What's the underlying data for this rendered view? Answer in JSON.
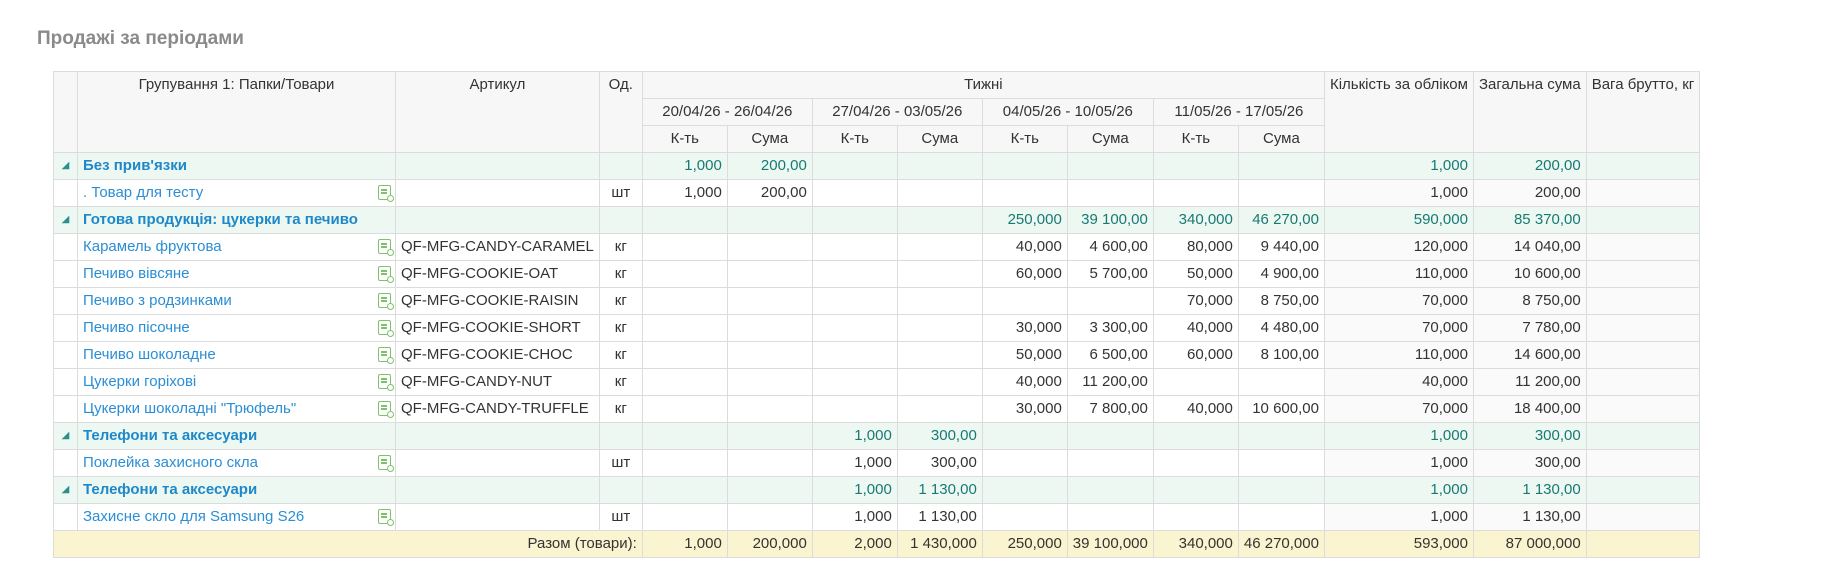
{
  "title": "Продажі за періодами",
  "header": {
    "grouping": "Групування 1: Папки/Товари",
    "article": "Артикул",
    "unit": "Од.",
    "weeks": "Тижні",
    "periods": [
      "20/04/26 - 26/04/26",
      "27/04/26 - 03/05/26",
      "04/05/26 - 10/05/26",
      "11/05/26 - 17/05/26"
    ],
    "qty": "К-ть",
    "sum": "Сума",
    "qty_total": "Кількість за обліком",
    "sum_total": "Загальна сума",
    "weight": "Вага брутто, кг"
  },
  "rows": [
    {
      "type": "group",
      "name": "Без прив'язки",
      "article": "",
      "unit": "",
      "cells": [
        "1,000",
        "200,00",
        "",
        "",
        "",
        "",
        "",
        ""
      ],
      "qty_total": "1,000",
      "sum_total": "200,00",
      "weight": ""
    },
    {
      "type": "item",
      "name": ". Товар для тесту",
      "article": "",
      "unit": "шт",
      "cells": [
        "1,000",
        "200,00",
        "",
        "",
        "",
        "",
        "",
        ""
      ],
      "qty_total": "1,000",
      "sum_total": "200,00",
      "weight": ""
    },
    {
      "type": "group",
      "name": "Готова продукція: цукерки та печиво",
      "article": "",
      "unit": "",
      "cells": [
        "",
        "",
        "",
        "",
        "250,000",
        "39 100,00",
        "340,000",
        "46 270,00"
      ],
      "qty_total": "590,000",
      "sum_total": "85 370,00",
      "weight": ""
    },
    {
      "type": "item",
      "name": "Карамель фруктова",
      "article": "QF-MFG-CANDY-CARAMEL",
      "unit": "кг",
      "cells": [
        "",
        "",
        "",
        "",
        "40,000",
        "4 600,00",
        "80,000",
        "9 440,00"
      ],
      "qty_total": "120,000",
      "sum_total": "14 040,00",
      "weight": ""
    },
    {
      "type": "item",
      "name": "Печиво вівсяне",
      "article": "QF-MFG-COOKIE-OAT",
      "unit": "кг",
      "cells": [
        "",
        "",
        "",
        "",
        "60,000",
        "5 700,00",
        "50,000",
        "4 900,00"
      ],
      "qty_total": "110,000",
      "sum_total": "10 600,00",
      "weight": ""
    },
    {
      "type": "item",
      "name": "Печиво з родзинками",
      "article": "QF-MFG-COOKIE-RAISIN",
      "unit": "кг",
      "cells": [
        "",
        "",
        "",
        "",
        "",
        "",
        "70,000",
        "8 750,00"
      ],
      "qty_total": "70,000",
      "sum_total": "8 750,00",
      "weight": ""
    },
    {
      "type": "item",
      "name": "Печиво пісочне",
      "article": "QF-MFG-COOKIE-SHORT",
      "unit": "кг",
      "cells": [
        "",
        "",
        "",
        "",
        "30,000",
        "3 300,00",
        "40,000",
        "4 480,00"
      ],
      "qty_total": "70,000",
      "sum_total": "7 780,00",
      "weight": ""
    },
    {
      "type": "item",
      "name": "Печиво шоколадне",
      "article": "QF-MFG-COOKIE-CHOC",
      "unit": "кг",
      "cells": [
        "",
        "",
        "",
        "",
        "50,000",
        "6 500,00",
        "60,000",
        "8 100,00"
      ],
      "qty_total": "110,000",
      "sum_total": "14 600,00",
      "weight": ""
    },
    {
      "type": "item",
      "name": "Цукерки горіхові",
      "article": "QF-MFG-CANDY-NUT",
      "unit": "кг",
      "cells": [
        "",
        "",
        "",
        "",
        "40,000",
        "11 200,00",
        "",
        ""
      ],
      "qty_total": "40,000",
      "sum_total": "11 200,00",
      "weight": ""
    },
    {
      "type": "item",
      "name": "Цукерки шоколадні \"Трюфель\"",
      "article": "QF-MFG-CANDY-TRUFFLE",
      "unit": "кг",
      "cells": [
        "",
        "",
        "",
        "",
        "30,000",
        "7 800,00",
        "40,000",
        "10 600,00"
      ],
      "qty_total": "70,000",
      "sum_total": "18 400,00",
      "weight": ""
    },
    {
      "type": "group",
      "name": "Телефони та аксесуари",
      "article": "",
      "unit": "",
      "cells": [
        "",
        "",
        "1,000",
        "300,00",
        "",
        "",
        "",
        ""
      ],
      "qty_total": "1,000",
      "sum_total": "300,00",
      "weight": ""
    },
    {
      "type": "item",
      "name": "Поклейка захисного скла",
      "article": "",
      "unit": "шт",
      "cells": [
        "",
        "",
        "1,000",
        "300,00",
        "",
        "",
        "",
        ""
      ],
      "qty_total": "1,000",
      "sum_total": "300,00",
      "weight": ""
    },
    {
      "type": "group",
      "name": "Телефони та аксесуари",
      "article": "",
      "unit": "",
      "cells": [
        "",
        "",
        "1,000",
        "1 130,00",
        "",
        "",
        "",
        ""
      ],
      "qty_total": "1,000",
      "sum_total": "1 130,00",
      "weight": ""
    },
    {
      "type": "item",
      "name": "Захисне скло для Samsung S26",
      "article": "",
      "unit": "шт",
      "cells": [
        "",
        "",
        "1,000",
        "1 130,00",
        "",
        "",
        "",
        ""
      ],
      "qty_total": "1,000",
      "sum_total": "1 130,00",
      "weight": ""
    }
  ],
  "total": {
    "label": "Разом (товари):",
    "cells": [
      "1,000",
      "200,000",
      "2,000",
      "1 430,000",
      "250,000",
      "39 100,000",
      "340,000",
      "46 270,000"
    ],
    "qty_total": "593,000",
    "sum_total": "87 000,000",
    "weight": ""
  },
  "icons": {
    "expand": "caret-expanded-icon",
    "item": "product-card-icon"
  },
  "colors": {
    "group_bg": "#eef8f3",
    "group_text": "#1e88c9",
    "link": "#2b8ed4",
    "total_bg": "#fbf4d0"
  }
}
